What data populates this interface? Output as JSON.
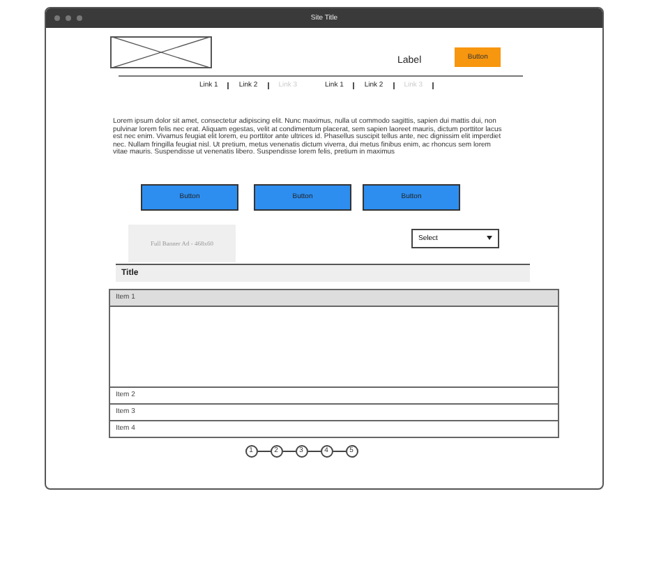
{
  "window": {
    "title": "Site Title"
  },
  "header": {
    "label": "Label",
    "button": "Button"
  },
  "nav_links": [
    {
      "label": "Link 1",
      "disabled": false
    },
    {
      "label": "Link 2",
      "disabled": false
    },
    {
      "label": "Link 3",
      "disabled": true
    },
    {
      "label": "Link 1",
      "disabled": false
    },
    {
      "label": "Link 2",
      "disabled": false
    },
    {
      "label": "Link 3",
      "disabled": true
    }
  ],
  "paragraph": "Lorem ipsum dolor sit amet, consectetur adipiscing elit. Nunc maximus, nulla ut commodo sagittis, sapien dui mattis dui, non pulvinar lorem felis nec erat. Aliquam egestas, velit at condimentum placerat, sem sapien laoreet mauris, dictum porttitor lacus est nec enim. Vivamus feugiat elit lorem, eu porttitor ante ultrices id. Phasellus suscipit tellus ante, nec dignissim elit imperdiet nec. Nullam fringilla feugiat nisl. Ut pretium, metus venenatis dictum viverra, dui metus finibus enim, ac rhoncus sem lorem vitae mauris. Suspendisse ut venenatis libero. Suspendisse lorem felis, pretium in maximus",
  "buttons": [
    "Button",
    "Button",
    "Button"
  ],
  "banner_ad": "Full Banner Ad - 468x60",
  "select": {
    "value": "Select"
  },
  "section_title": "Title",
  "accordion": [
    {
      "label": "Item 1",
      "expanded": true
    },
    {
      "label": "Item 2",
      "expanded": false
    },
    {
      "label": "Item 3",
      "expanded": false
    },
    {
      "label": "Item 4",
      "expanded": false
    }
  ],
  "pager": [
    "1",
    "2",
    "3",
    "4",
    "5"
  ]
}
